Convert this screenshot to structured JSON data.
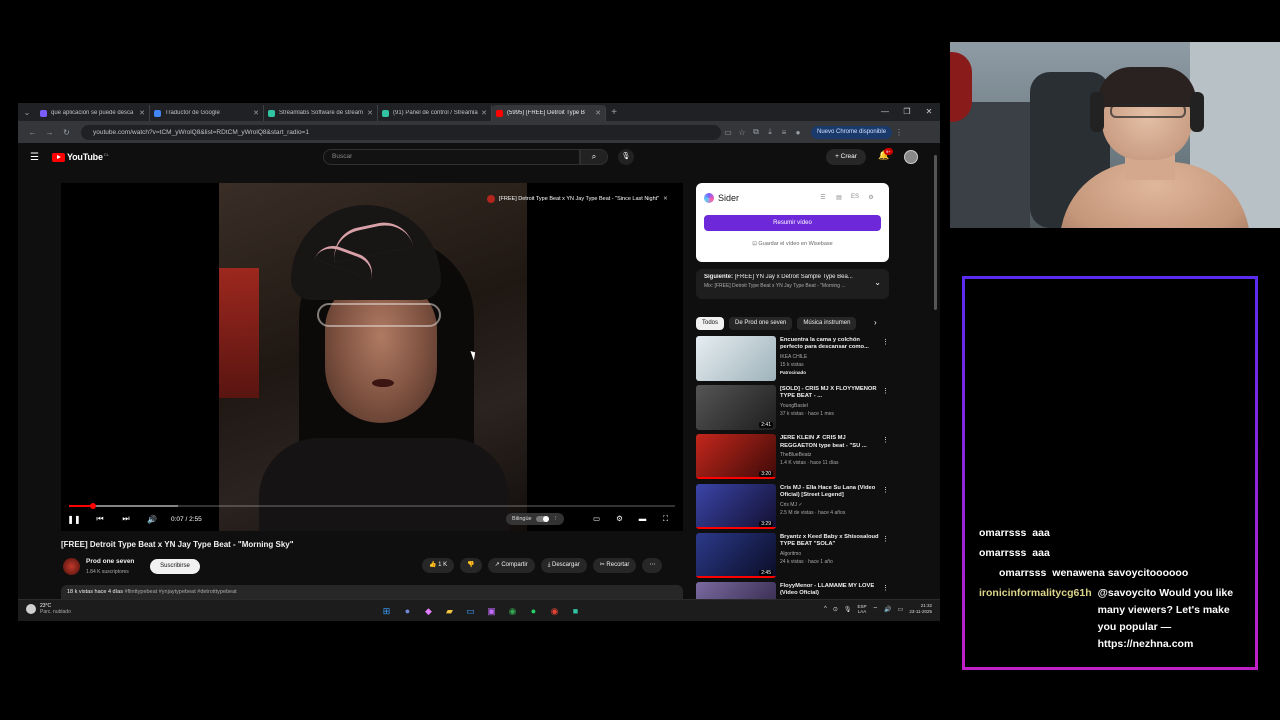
{
  "browser": {
    "tabs": [
      {
        "label": "que aplicacion se puede desca",
        "color": "#7b5cff",
        "active": false
      },
      {
        "label": "Traductor de Google",
        "color": "#4285f4",
        "active": false
      },
      {
        "label": "Streamlabs Software de stream",
        "color": "#31c3a2",
        "active": false
      },
      {
        "label": "(91) Panel de control / Streamla",
        "color": "#31c3a2",
        "active": false
      },
      {
        "label": "(5995) [FREE] Detroit Type B",
        "color": "#ff0000",
        "active": true
      }
    ],
    "url": "youtube.com/watch?v=tCM_yWrolQ8&list=RDtCM_yWrolQ8&start_radio=1",
    "chrome_update": "Nuevo Chrome disponible"
  },
  "youtube": {
    "logo": "YouTube",
    "country": "CL",
    "search_placeholder": "Buscar",
    "create_label": "Crear",
    "notif_count": "9+"
  },
  "player": {
    "overlay_title": "[FREE] Detroit Type Beat x YN Jay Type Beat - \"Since Last Night\"",
    "time": "0:07 / 2:55",
    "progress": 0.04,
    "buffered": 0.18,
    "bilingual_label": "Bilingüe"
  },
  "video": {
    "title": "[FREE] Detroit Type Beat x YN Jay Type Beat - \"Morning Sky\"",
    "channel": "Prod one seven",
    "subscribers": "1.84 K suscriptores",
    "subscribe_label": "Suscribirse",
    "likes": "1 K",
    "share": "Compartir",
    "download": "Descargar",
    "clip": "Recortar",
    "views_date": "18 k vistas  hace 4 días",
    "tags": "#flinttypebeat #ynjaytypebeat #detroittypebeat"
  },
  "sider": {
    "name": "Sider",
    "summarize": "Resumir vídeo",
    "save": "Guardar el vídeo en Wisebase"
  },
  "up_next": {
    "label": "Siguiente:",
    "title": "[FREE] YN Jay x Detroit Sample Type Bea...",
    "mix": "Mix: [FREE] Detroit Type Beat x YN Jay Type Beat - \"Morning ..."
  },
  "chips": [
    "Todos",
    "De Prod one seven",
    "Música instrumen"
  ],
  "recommendations": [
    {
      "title": "Encuentra la cama y colchón perfecto para descansar como...",
      "channel": "IKEA CHILE",
      "meta": "15 k vistas",
      "badge": "Patrocinado",
      "duration": "",
      "thumb": "#c9d6dc"
    },
    {
      "title": "[SOLD] - CRIS MJ X FLOYYMENOR TYPE BEAT - ...",
      "channel": "YoungBastel",
      "meta": "37 k vistas · hace 1 mes",
      "badge": "",
      "duration": "2:41",
      "thumb": "#3a3a3a"
    },
    {
      "title": "JERE KLEIN ✗ CRIS MJ REGGAETON type beat - \"SU ...",
      "channel": "TheBlueBeatz",
      "meta": "1.4 K vistas · hace 11 días",
      "badge": "",
      "duration": "3:20",
      "thumb": "#8a1a14"
    },
    {
      "title": "Cris MJ - Ella Hace Su Lana (Video Oficial) [Street Legend]",
      "channel": "Cris MJ ✓",
      "meta": "2.5 M de vistas · hace 4 años",
      "badge": "",
      "duration": "3:29",
      "thumb": "#2a2f6a"
    },
    {
      "title": "Bryantz x Keed Baby x Shisosaloud TYPE BEAT \"SOLA\"",
      "channel": "Algoritmo",
      "meta": "24 k vistas · hace 1 año",
      "badge": "",
      "duration": "2:45",
      "thumb": "#1b2660"
    },
    {
      "title": "FloyyMenor - LLÁMAME MY LOVE (Video Oficial)",
      "channel": "",
      "meta": "",
      "badge": "",
      "duration": "",
      "thumb": "#5a4a7a"
    }
  ],
  "taskbar": {
    "temp": "23°C",
    "weather": "Parc. nublado",
    "lang1": "ESP",
    "lang2": "LAA",
    "time": "21:32",
    "date": "23-11-2025"
  },
  "chat": [
    {
      "user": "omarrsss",
      "msg": "aaa",
      "indent": false
    },
    {
      "user": "omarrsss",
      "msg": "aaa",
      "indent": false
    },
    {
      "user": "omarrsss",
      "msg": "wenawena savoycitoooooo",
      "indent": true
    },
    {
      "user": "ironicinformalitycg61h",
      "msg": "@savoycito Would you like many viewers? Let's make you popular — https://nezhna.com",
      "indent": false
    }
  ]
}
